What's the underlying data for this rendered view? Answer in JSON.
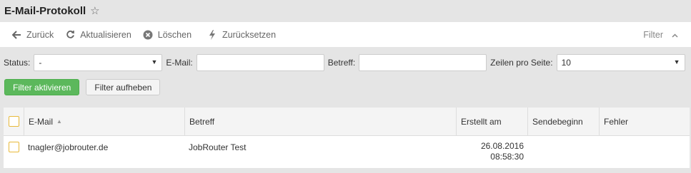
{
  "header": {
    "title": "E-Mail-Protokoll"
  },
  "toolbar": {
    "back_label": "Zurück",
    "refresh_label": "Aktualisieren",
    "delete_label": "Löschen",
    "reset_label": "Zurücksetzen",
    "filter_label": "Filter"
  },
  "filters": {
    "status_label": "Status:",
    "status_value": "-",
    "email_label": "E-Mail:",
    "email_value": "",
    "subject_label": "Betreff:",
    "subject_value": "",
    "rows_label": "Zeilen pro Seite:",
    "rows_value": "10",
    "apply_label": "Filter aktivieren",
    "clear_label": "Filter aufheben"
  },
  "table": {
    "headers": {
      "email": "E-Mail",
      "subject": "Betreff",
      "created": "Erstellt am",
      "send_start": "Sendebeginn",
      "error": "Fehler"
    },
    "rows": [
      {
        "email": "tnagler@jobrouter.de",
        "subject": "JobRouter Test",
        "created_date": "26.08.2016",
        "created_time": "08:58:30",
        "send_start": "",
        "error": ""
      }
    ]
  },
  "colors": {
    "accent_green": "#5cb85c",
    "checkbox_border": "#e8b93a",
    "background": "#e5e5e5"
  }
}
